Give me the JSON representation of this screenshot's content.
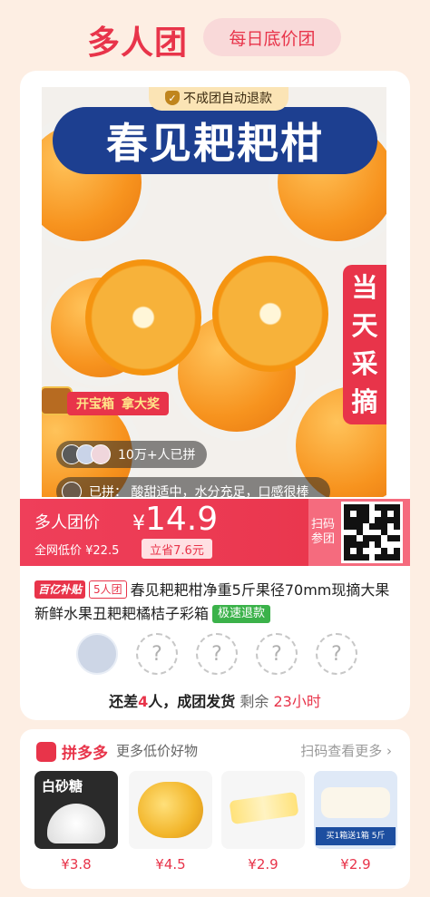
{
  "header": {
    "logo": "多人团",
    "daily_button": "每日底价团"
  },
  "product_image": {
    "refund_tag": "不成团自动退款",
    "title": "春见耙耙柑",
    "vertical_tag": [
      "当",
      "天",
      "采",
      "摘"
    ],
    "treasure": {
      "part1": "开宝箱",
      "part2": "拿大奖"
    },
    "joined_text": "10万+人已拼",
    "review_text": "已拼：  酸甜适中，水分充足，口感很棒"
  },
  "price": {
    "label": "多人团价",
    "currency": "¥",
    "value": "14.9",
    "original": "全网低价 ¥22.5",
    "save": "立省7.6元",
    "qr_label": "扫码参团"
  },
  "description": {
    "badge_subsidy": "百亿补贴",
    "badge_group": "5人团",
    "text": "春见耙耙柑净重5斤果径70mm现摘大果新鲜水果丑耙耙橘桔子彩箱",
    "badge_refund": "极速退款"
  },
  "members": {
    "slots": [
      "?",
      "?",
      "?",
      "?"
    ]
  },
  "status": {
    "prefix": "还差",
    "count": "4",
    "suffix": "人，成团发货",
    "remaining_label": "剩余",
    "remaining_time": "23小时"
  },
  "recommend": {
    "brand": "拼多多",
    "more_low": "更多低价好物",
    "scan_more": "扫码查看更多",
    "products": [
      {
        "price": "¥3.8"
      },
      {
        "price": "¥4.5"
      },
      {
        "price": "¥2.9"
      },
      {
        "price": "¥2.9"
      }
    ],
    "sugar_label": "白砂糖",
    "bun_label": "买1箱送1箱 5斤"
  },
  "colors": {
    "accent": "#e8344a",
    "background": "#fdeee3",
    "title_banner": "#1d3f90",
    "refund_green": "#3bb24a"
  }
}
